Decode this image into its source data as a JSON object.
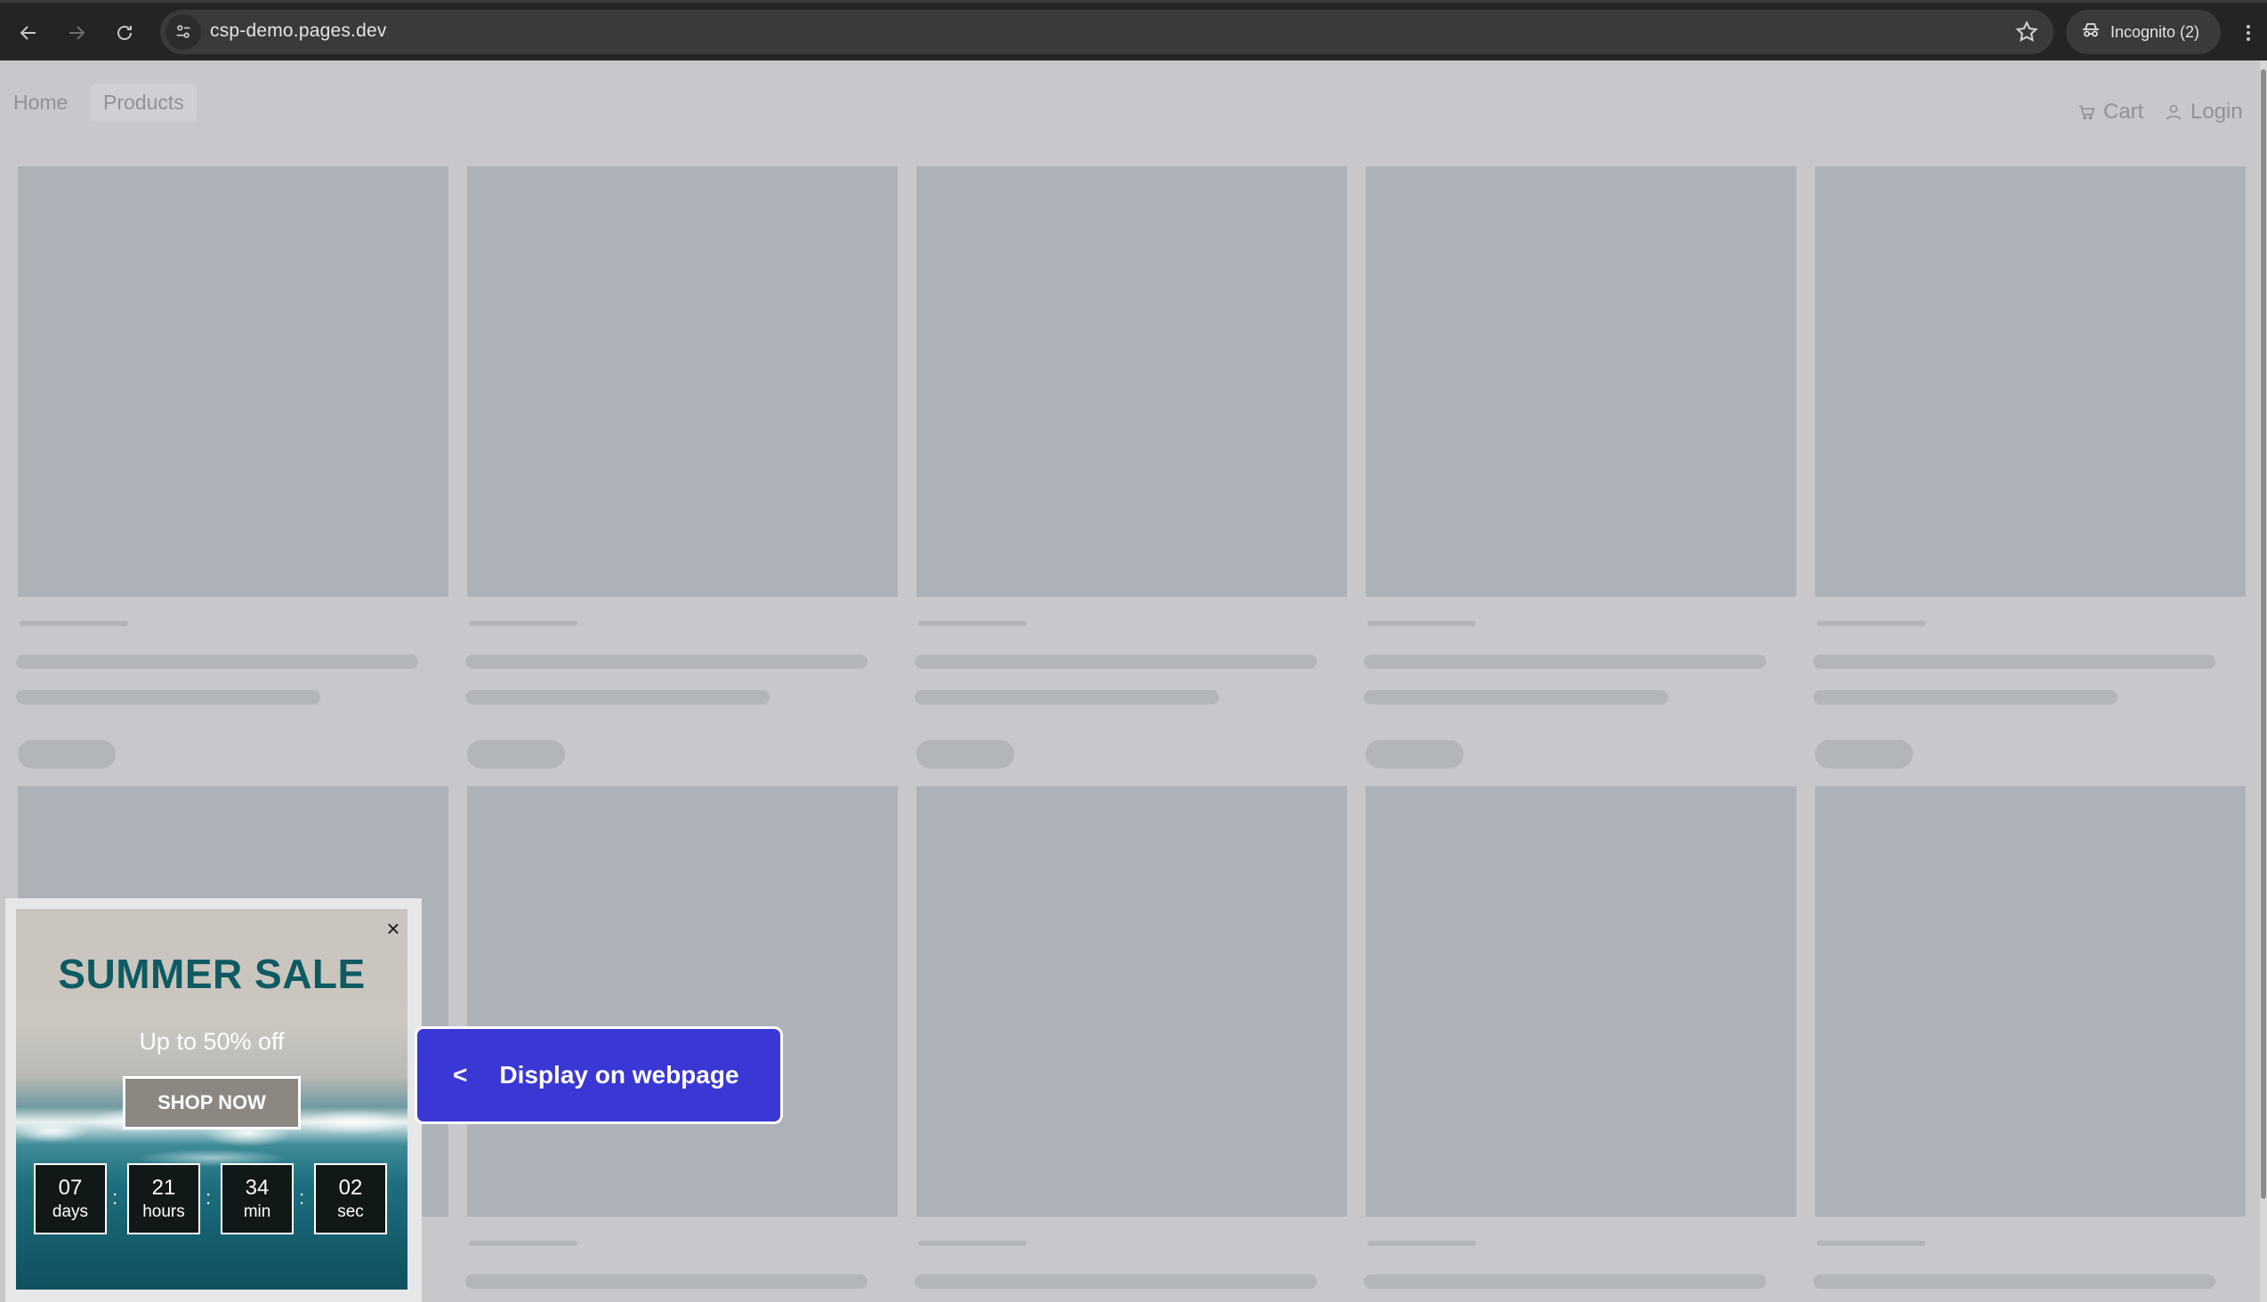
{
  "browser": {
    "url": "csp-demo.pages.dev",
    "incognito_label": "Incognito (2)",
    "icons": {
      "back": "back-arrow-icon",
      "forward": "forward-arrow-icon",
      "reload": "reload-icon",
      "site_info": "tune-icon",
      "bookmark": "star-icon",
      "incognito": "incognito-icon",
      "menu": "kebab-menu-icon"
    }
  },
  "site_nav": {
    "home": "Home",
    "products": "Products",
    "cart": "Cart",
    "login": "Login"
  },
  "popup": {
    "title": "SUMMER SALE",
    "subtitle": "Up to 50% off",
    "cta": "SHOP NOW",
    "close": "×",
    "countdown": [
      {
        "value": "07",
        "unit": "days"
      },
      {
        "value": "21",
        "unit": "hours"
      },
      {
        "value": "34",
        "unit": "min"
      },
      {
        "value": "02",
        "unit": "sec"
      }
    ],
    "separator": ":"
  },
  "display_button": {
    "chevron": "<",
    "label": "Display on webpage"
  },
  "colors": {
    "accent": "#3b37d4",
    "popup_title": "#0e5a63",
    "skeleton": "#acb2b8"
  }
}
